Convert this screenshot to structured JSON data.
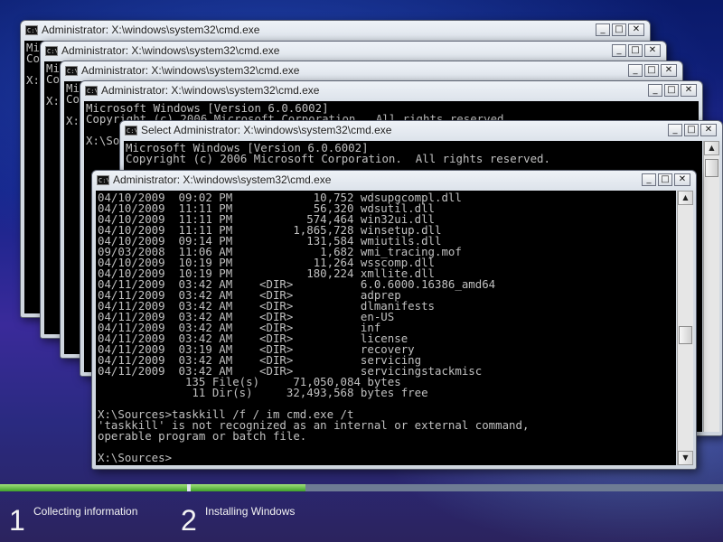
{
  "windows": [
    {
      "title": "Administrator: X:\\windows\\system32\\cmd.exe",
      "console_text": "Mi\nCo\n\nX:"
    },
    {
      "title": "Administrator: X:\\windows\\system32\\cmd.exe",
      "console_text": "Mi\nCo\n\nX:"
    },
    {
      "title": "Administrator: X:\\windows\\system32\\cmd.exe",
      "console_text": "Mi\nCo\n\nX:"
    },
    {
      "title": "Administrator: X:\\windows\\system32\\cmd.exe",
      "console_text": "Microsoft Windows [Version 6.0.6002]\nCopyright (c) 2006 Microsoft Corporation.  All rights reserved.\n\nX:\\So"
    },
    {
      "title": "Select Administrator: X:\\windows\\system32\\cmd.exe",
      "console_text": "Microsoft Windows [Version 6.0.6002]\nCopyright (c) 2006 Microsoft Corporation.  All rights reserved."
    },
    {
      "title": "Administrator: X:\\windows\\system32\\cmd.exe",
      "console_text": "04/10/2009  09:02 PM            10,752 wdsupgcompl.dll\n04/10/2009  11:11 PM            56,320 wdsutil.dll\n04/10/2009  11:11 PM           574,464 win32ui.dll\n04/10/2009  11:11 PM         1,865,728 winsetup.dll\n04/10/2009  09:14 PM           131,584 wmiutils.dll\n09/03/2008  11:06 AM             1,682 wmi_tracing.mof\n04/10/2009  10:19 PM            11,264 wsscomp.dll\n04/10/2009  10:19 PM           180,224 xmllite.dll\n04/11/2009  03:42 AM    <DIR>          6.0.6000.16386_amd64\n04/11/2009  03:42 AM    <DIR>          adprep\n04/11/2009  03:42 AM    <DIR>          dlmanifests\n04/11/2009  03:42 AM    <DIR>          en-US\n04/11/2009  03:42 AM    <DIR>          inf\n04/11/2009  03:42 AM    <DIR>          license\n04/11/2009  03:19 AM    <DIR>          recovery\n04/11/2009  03:42 AM    <DIR>          servicing\n04/11/2009  03:42 AM    <DIR>          servicingstackmisc\n             135 File(s)     71,050,084 bytes\n              11 Dir(s)     32,493,568 bytes free\n\nX:\\Sources>taskkill /f / im cmd.exe /t\n'taskkill' is not recognized as an internal or external command,\noperable program or batch file.\n\nX:\\Sources>"
    }
  ],
  "window_controls": {
    "minimize": "_",
    "maximize": "□",
    "close": "✕"
  },
  "icons": {
    "app": "cmd-icon",
    "cursor": "mouse-pointer-icon"
  },
  "setup": {
    "progress_fraction": 0.42,
    "steps": [
      {
        "number": "1",
        "label": "Collecting information"
      },
      {
        "number": "2",
        "label": "Installing Windows"
      }
    ]
  }
}
